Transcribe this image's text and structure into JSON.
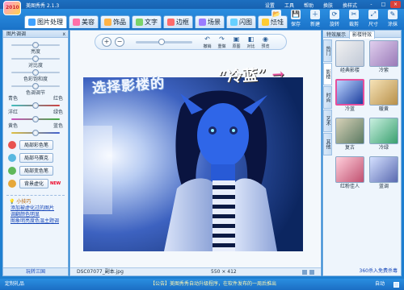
{
  "window": {
    "logo_text": "2010",
    "title": "美图秀秀 2.1.3",
    "menus": [
      "设置",
      "工具",
      "帮助",
      "换肤",
      "换样式"
    ],
    "controls": [
      "-",
      "□",
      "×"
    ]
  },
  "tabs": [
    {
      "label": "图片处理",
      "color": "#3fa1ff",
      "icon": "photo-icon"
    },
    {
      "label": "美容",
      "color": "#ff6fa8",
      "icon": "beauty-icon"
    },
    {
      "label": "饰品",
      "color": "#ffb347",
      "icon": "accessory-icon"
    },
    {
      "label": "文字",
      "color": "#7ad36a",
      "icon": "text-icon"
    },
    {
      "label": "边框",
      "color": "#ff6b6b",
      "icon": "frame-icon"
    },
    {
      "label": "场景",
      "color": "#9a7bff",
      "icon": "scene-icon"
    },
    {
      "label": "闪图",
      "color": "#66d0ff",
      "icon": "flash-icon"
    },
    {
      "label": "娃娃",
      "color": "#ffcc33",
      "icon": "doll-icon"
    }
  ],
  "actions": [
    {
      "label": "打开",
      "icon": "open-folder-icon"
    },
    {
      "label": "保存",
      "icon": "save-icon"
    },
    {
      "label": "新建",
      "icon": "new-icon"
    },
    {
      "label": "旋转",
      "icon": "rotate-icon"
    },
    {
      "label": "裁剪",
      "icon": "crop-icon"
    },
    {
      "label": "尺寸",
      "icon": "resize-icon"
    },
    {
      "label": "涂抹",
      "icon": "smudge-icon"
    }
  ],
  "left_panel": {
    "header": "图片调调",
    "close": "x",
    "sliders": {
      "brightness": "亮度",
      "contrast": "对比度",
      "saturation": "色彩饱和度",
      "color_adjust": "色调调节"
    },
    "color_pairs": [
      {
        "left": "青色",
        "right": "红色"
      },
      {
        "left": "洋红",
        "right": "绿色"
      },
      {
        "left": "黄色",
        "right": "蓝色"
      }
    ],
    "buttons": [
      {
        "label": "局部彩色笔",
        "color": "#e8534f"
      },
      {
        "label": "局部马赛克",
        "color": "#58b8e0"
      },
      {
        "label": "局部变色笔",
        "color": "#5fb85a"
      },
      {
        "label": "背景虚化",
        "color": "#e6a83a",
        "badge": "NEW"
      }
    ],
    "tips_title": "小技巧",
    "tips": [
      "添加被虚化过的图片",
      "调翻颜色明显",
      "图象明亮度色温主题调"
    ],
    "footer": "玩转三国"
  },
  "canvas": {
    "zoom_in": "+",
    "zoom_out": "−",
    "tools": [
      {
        "label": "撤销",
        "icon": "undo-icon",
        "glyph": "↶"
      },
      {
        "label": "重做",
        "icon": "redo-icon",
        "glyph": "↷"
      },
      {
        "label": "原图",
        "icon": "original-icon",
        "glyph": "▣"
      },
      {
        "label": "对比",
        "icon": "compare-icon",
        "glyph": "◧"
      },
      {
        "label": "预览",
        "icon": "preview-icon",
        "glyph": "◉"
      }
    ],
    "annotation_left": "选择影楼的",
    "annotation_right": "“冷蓝”",
    "arrow": "→",
    "filename": "DSC07077_副本.jpg",
    "dimensions": "550 × 412"
  },
  "right_panel": {
    "tabs_header": [
      "特效展示",
      "影楼特效"
    ],
    "vtabs": [
      "热门",
      "影楼",
      "时尚",
      "艺术",
      "其他"
    ],
    "effects": [
      {
        "label": "经典影楼",
        "colors": [
          "#f2f2f2",
          "#c0c8d6"
        ]
      },
      {
        "label": "冷紫",
        "colors": [
          "#e0cfee",
          "#9a7ab8"
        ]
      },
      {
        "label": "冷蓝",
        "colors": [
          "#bcd4ff",
          "#1c3e9e"
        ],
        "selected": true
      },
      {
        "label": "暖黄",
        "colors": [
          "#f6e3b8",
          "#b8904a"
        ]
      },
      {
        "label": "复古",
        "colors": [
          "#d8d2b8",
          "#5b7a62"
        ]
      },
      {
        "label": "冷绿",
        "colors": [
          "#c9f0e0",
          "#3aa06f"
        ]
      },
      {
        "label": "红粉佳人",
        "colors": [
          "#ffd0dc",
          "#c05070"
        ]
      },
      {
        "label": "蓝调",
        "colors": [
          "#d4e0ff",
          "#5a6ab0"
        ]
      }
    ],
    "footer": "360杀入免费杀毒"
  },
  "status": {
    "left": "定制礼品",
    "notice": "【公告】美图秀秀自动升级程序，在软件发布的一周后推出",
    "right": "自动",
    "checkbox_color": "#d6eaff"
  }
}
